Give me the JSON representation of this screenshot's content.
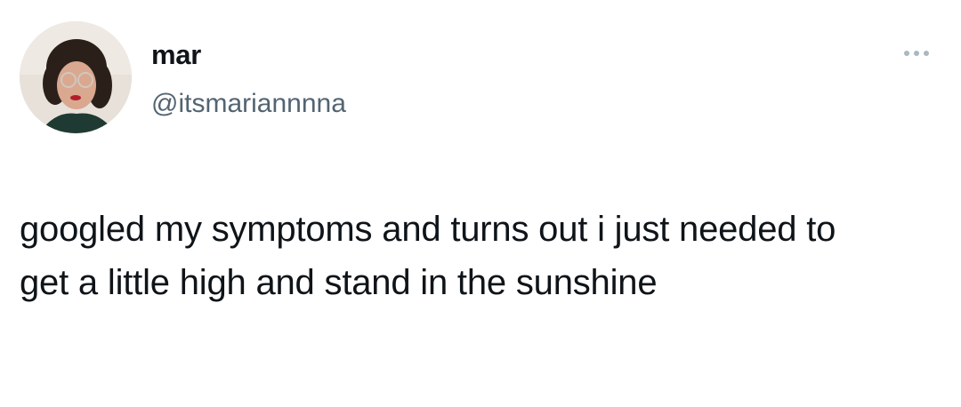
{
  "author": {
    "display_name": "mar",
    "handle": "@itsmariannnna"
  },
  "tweet": {
    "text": "googled my symptoms and turns out i just needed to get a little high and stand in the sunshine"
  },
  "icons": {
    "more": "more-horizontal-icon"
  },
  "colors": {
    "text_primary": "#0f1419",
    "text_secondary": "#536471",
    "background": "#ffffff"
  }
}
